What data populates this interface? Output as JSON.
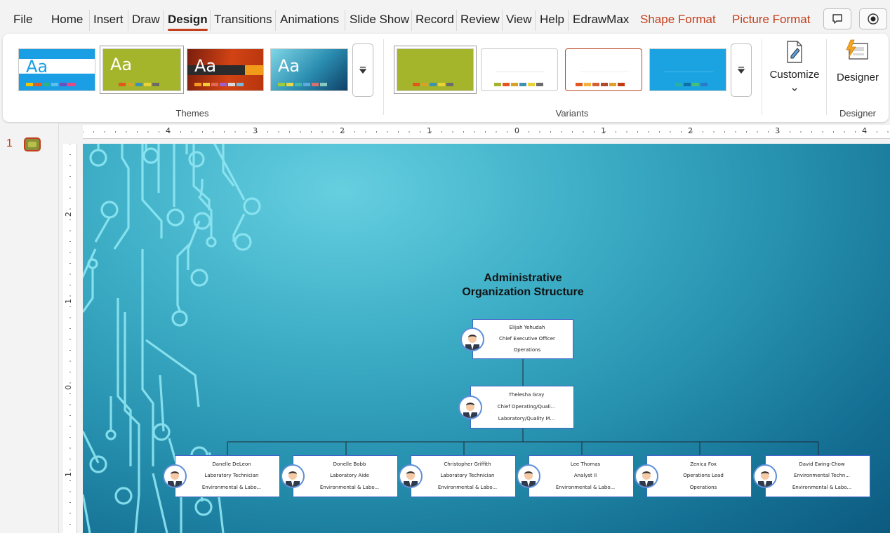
{
  "menu": {
    "tabs": [
      "File",
      "Home",
      "Insert",
      "Draw",
      "Design",
      "Transitions",
      "Animations",
      "Slide Show",
      "Record",
      "Review",
      "View",
      "Help",
      "EdrawMax"
    ],
    "active": "Design",
    "contextual": [
      "Shape Format",
      "Picture Format"
    ]
  },
  "ribbon": {
    "themes_label": "Themes",
    "variants_label": "Variants",
    "designer_group_label": "Designer",
    "customize_label": "Customize",
    "designer_label": "Designer",
    "theme_sample_text": "Aa"
  },
  "slide_panel": {
    "slide_number": "1"
  },
  "rulers": {
    "horizontal": [
      "4",
      "3",
      "2",
      "1",
      "0",
      "1",
      "2",
      "3",
      "4"
    ],
    "vertical": [
      "2",
      "1",
      "0",
      "1"
    ]
  },
  "slide": {
    "title_line1": "Administrative",
    "title_line2": "Organization Structure",
    "ceo": {
      "name": "Elijah Yehudah",
      "title": "Chief Executive Officer",
      "dept": "Operations"
    },
    "coo": {
      "name": "Thelesha Gray",
      "title": "Chief Operating/Quali...",
      "dept": "Laboratory/Quality M..."
    },
    "staff": [
      {
        "name": "Danelle DeLeon",
        "title": "Laboratory Technician",
        "dept": "Environmental & Labo..."
      },
      {
        "name": "Donelle Bobb",
        "title": "Laboratory Aide",
        "dept": "Environmental & Labo..."
      },
      {
        "name": "Christopher Griffith",
        "title": "Laboratory Technician",
        "dept": "Environmental & Labo..."
      },
      {
        "name": "Lee Thomas",
        "title": "Analyst II",
        "dept": "Environmental & Labo..."
      },
      {
        "name": "Zenica Fox",
        "title": "Operations Lead",
        "dept": "Operations"
      },
      {
        "name": "David Ewing-Chow",
        "title": "Environmental Techn...",
        "dept": "Environmental & Labo..."
      }
    ]
  },
  "colors": {
    "accent": "#c43e1c",
    "node_border": "#3f66c8",
    "slide_dark": "#0d5a80",
    "slide_light": "#66cfe0"
  },
  "icons": [
    "comment-icon",
    "record-icon",
    "dropdown-icon",
    "customize-icon",
    "designer-icon",
    "chevron-down-icon",
    "avatar-icon"
  ]
}
